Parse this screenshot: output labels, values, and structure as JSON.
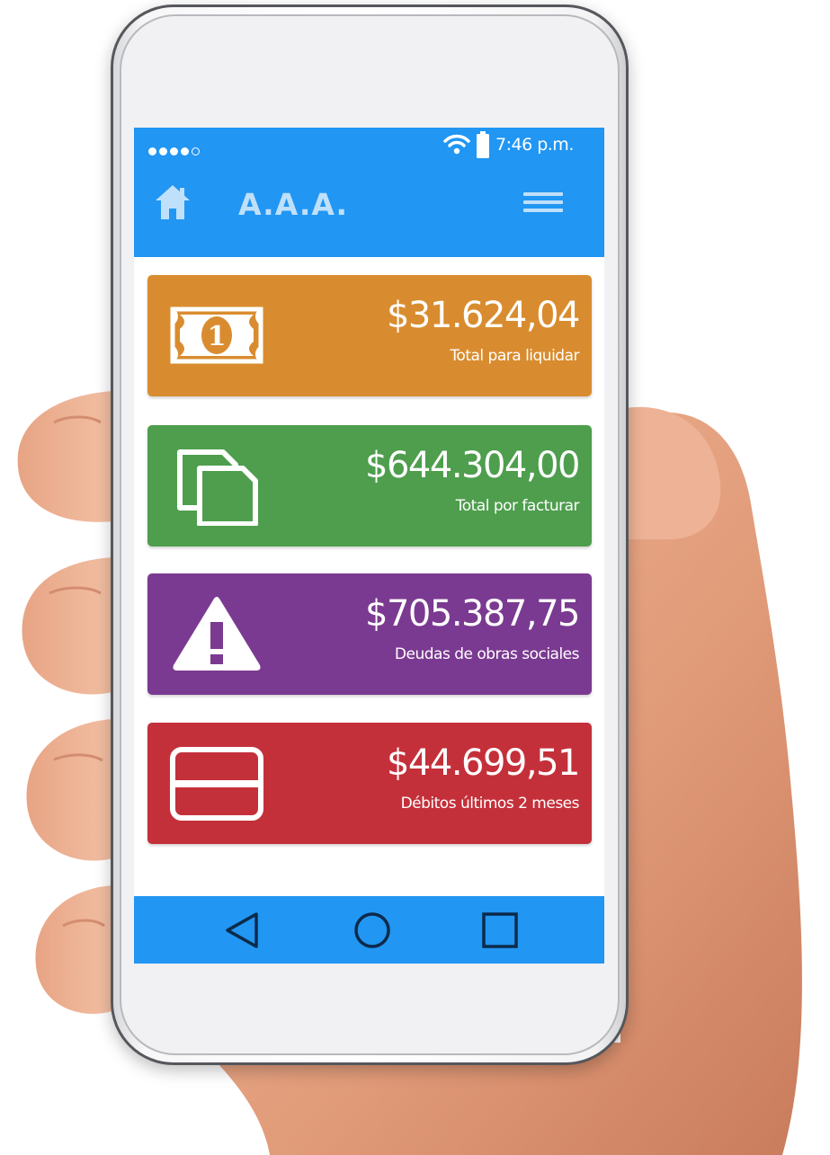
{
  "status_bar": {
    "time": "7:46 p.m."
  },
  "header": {
    "title": "A.A.A."
  },
  "cards": [
    {
      "amount": "$31.624,04",
      "caption": "Total para liquidar",
      "color": "#d98c2f",
      "icon": "banknote-icon"
    },
    {
      "amount": "$644.304,00",
      "caption": "Total por facturar",
      "color": "#4e9e4d",
      "icon": "documents-icon"
    },
    {
      "amount": "$705.387,75",
      "caption": "Deudas de obras sociales",
      "color": "#7b3a91",
      "icon": "warning-icon"
    },
    {
      "amount": "$44.699,51",
      "caption": "Débitos últimos 2 meses",
      "color": "#c4303a",
      "icon": "credit-card-icon"
    }
  ],
  "nav_bar": {
    "buttons": [
      "back-icon",
      "home-circle-icon",
      "recent-apps-icon"
    ]
  },
  "theme": {
    "primary": "#2196f3"
  }
}
